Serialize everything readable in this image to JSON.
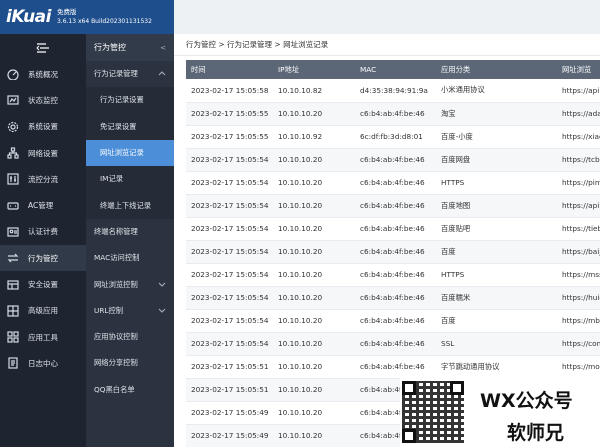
{
  "header": {
    "logo": "iKuai",
    "edition": "免费版",
    "build": "3.6.13 x64 Build202301131532"
  },
  "sidebar": {
    "items": [
      {
        "label": "系统概况",
        "icon": "speedometer-icon"
      },
      {
        "label": "状态监控",
        "icon": "monitor-icon"
      },
      {
        "label": "系统设置",
        "icon": "gear-icon"
      },
      {
        "label": "网络设置",
        "icon": "network-icon"
      },
      {
        "label": "流控分流",
        "icon": "flow-control-icon"
      },
      {
        "label": "AC管理",
        "icon": "ac-icon"
      },
      {
        "label": "认证计费",
        "icon": "auth-icon"
      },
      {
        "label": "行为管控",
        "icon": "behavior-icon"
      },
      {
        "label": "安全设置",
        "icon": "security-icon"
      },
      {
        "label": "高级应用",
        "icon": "advanced-icon"
      },
      {
        "label": "应用工具",
        "icon": "tools-icon"
      },
      {
        "label": "日志中心",
        "icon": "log-icon"
      }
    ]
  },
  "submenu": {
    "title": "行为管控",
    "items": [
      {
        "label": "行为记录管理",
        "type": "group",
        "chevron": "^"
      },
      {
        "label": "行为记录设置",
        "type": "child"
      },
      {
        "label": "免记录设置",
        "type": "child"
      },
      {
        "label": "网址浏览记录",
        "type": "child",
        "selected": true
      },
      {
        "label": "IM记录",
        "type": "child"
      },
      {
        "label": "终端上下线记录",
        "type": "child"
      },
      {
        "label": "终端名称管理",
        "type": "item"
      },
      {
        "label": "MAC访问控制",
        "type": "item"
      },
      {
        "label": "网址浏览控制",
        "type": "group",
        "chevron": "v"
      },
      {
        "label": "URL控制",
        "type": "group",
        "chevron": "v"
      },
      {
        "label": "应用协议控制",
        "type": "item"
      },
      {
        "label": "网络分享控制",
        "type": "item"
      },
      {
        "label": "QQ黑白名单",
        "type": "item"
      }
    ]
  },
  "breadcrumb": "行为管控 > 行为记录管理 > 网址浏览记录",
  "table": {
    "columns": [
      "时间",
      "IP地址",
      "MAC",
      "应用分类",
      "网址浏览"
    ],
    "rows": [
      [
        "2023-02-17 15:05:58",
        "10.10.10.82",
        "d4:35:38:94:91:9a",
        "小米通用协议",
        "https://api."
      ],
      [
        "2023-02-17 15:05:55",
        "10.10.10.20",
        "c6:b4:ab:4f:be:46",
        "淘宝",
        "https://ada"
      ],
      [
        "2023-02-17 15:05:55",
        "10.10.10.92",
        "6c:df:fb:3d:d8:01",
        "百度-小度",
        "https://xiac"
      ],
      [
        "2023-02-17 15:05:54",
        "10.10.10.20",
        "c6:b4:ab:4f:be:46",
        "百度网盘",
        "https://tcbc"
      ],
      [
        "2023-02-17 15:05:54",
        "10.10.10.20",
        "c6:b4:ab:4f:be:46",
        "HTTPS",
        "https://pim"
      ],
      [
        "2023-02-17 15:05:54",
        "10.10.10.20",
        "c6:b4:ab:4f:be:46",
        "百度地图",
        "https://api."
      ],
      [
        "2023-02-17 15:05:54",
        "10.10.10.20",
        "c6:b4:ab:4f:be:46",
        "百度贴吧",
        "https://tieb"
      ],
      [
        "2023-02-17 15:05:54",
        "10.10.10.20",
        "c6:b4:ab:4f:be:46",
        "百度",
        "https://baij"
      ],
      [
        "2023-02-17 15:05:54",
        "10.10.10.20",
        "c6:b4:ab:4f:be:46",
        "HTTPS",
        "https://mss"
      ],
      [
        "2023-02-17 15:05:54",
        "10.10.10.20",
        "c6:b4:ab:4f:be:46",
        "百度糯米",
        "https://huic"
      ],
      [
        "2023-02-17 15:05:54",
        "10.10.10.20",
        "c6:b4:ab:4f:be:46",
        "百度",
        "https://mbc"
      ],
      [
        "2023-02-17 15:05:54",
        "10.10.10.20",
        "c6:b4:ab:4f:be:46",
        "SSL",
        "https://com"
      ],
      [
        "2023-02-17 15:05:51",
        "10.10.10.20",
        "c6:b4:ab:4f:be:46",
        "字节跳动通用协议",
        "https://mor"
      ],
      [
        "2023-02-17 15:05:51",
        "10.10.10.20",
        "c6:b4:ab:4f:",
        "",
        ""
      ],
      [
        "2023-02-17 15:05:49",
        "10.10.10.20",
        "c6:b4:ab:4f:",
        "",
        ""
      ],
      [
        "2023-02-17 15:05:49",
        "10.10.10.20",
        "c6:b4:ab:4f:",
        "",
        ""
      ]
    ]
  },
  "watermark": {
    "line1": "WX公众号",
    "line2": "软师兄"
  }
}
